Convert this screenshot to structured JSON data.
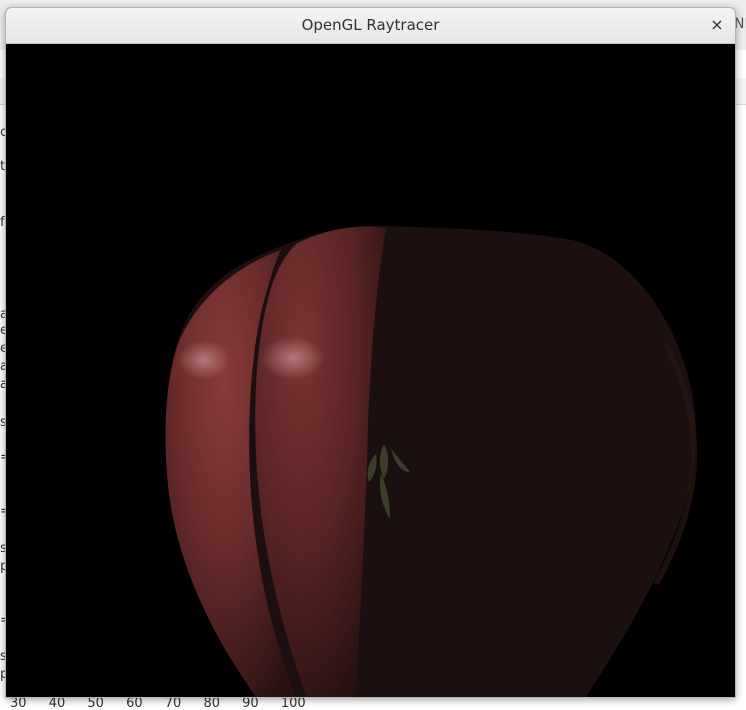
{
  "window": {
    "title": "OpenGL Raytracer",
    "close_glyph": "×"
  },
  "viewport": {
    "background_color": "#000000",
    "object": "apple",
    "object_color": "#6b2c2c",
    "shadow_color": "#1a0f0f",
    "leaf_color": "#3b3f2a"
  },
  "background_app": {
    "right_tab_text": "NR",
    "left_edge_chars": [
      "c",
      "t",
      "f",
      "a",
      "e",
      "e",
      "a",
      "a",
      "s",
      "=",
      "=",
      "s",
      "p",
      "=",
      "s",
      "p"
    ],
    "axis_ticks": [
      "30",
      "40",
      "50",
      "60",
      "70",
      "80",
      "90",
      "100"
    ]
  }
}
